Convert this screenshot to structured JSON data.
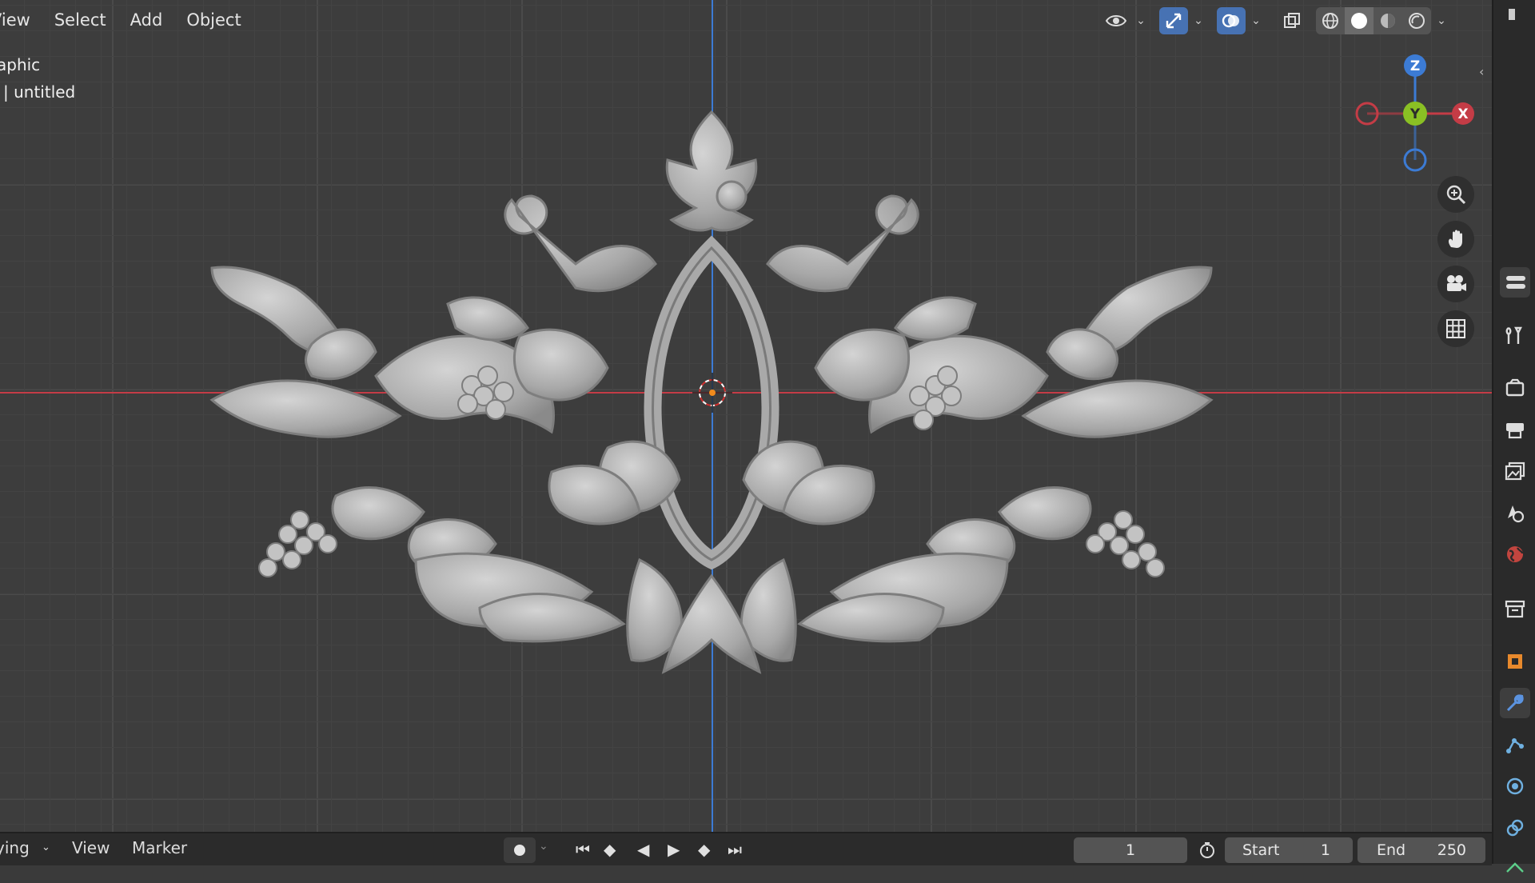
{
  "header_menu": {
    "view": "View",
    "select": "Select",
    "add": "Add",
    "object": "Object"
  },
  "viewport_info": {
    "line1": "aphic",
    "line2": "| untitled"
  },
  "toolbar": {
    "visibility_icon": "eye-icon",
    "gizmo_icon": "transform-gizmo-icon",
    "overlay_icon": "overlay-icon",
    "xray_icon": "xray-icon",
    "shading_modes": [
      "wireframe",
      "solid",
      "material-preview",
      "rendered"
    ],
    "active_shading": "solid"
  },
  "nav_gizmo": {
    "z_label": "Z",
    "y_label": "Y",
    "x_label": "X"
  },
  "timeline": {
    "mode": "ying",
    "view": "View",
    "marker": "Marker",
    "current_frame": "1",
    "start_label": "Start",
    "start_value": "1",
    "end_label": "End",
    "end_value": "250"
  },
  "colors": {
    "x_axis": "#c43c46",
    "z_axis": "#3c7bd4",
    "y_axis": "#8ac024",
    "active_button": "#4772b3",
    "model": "#b9b9b9"
  }
}
